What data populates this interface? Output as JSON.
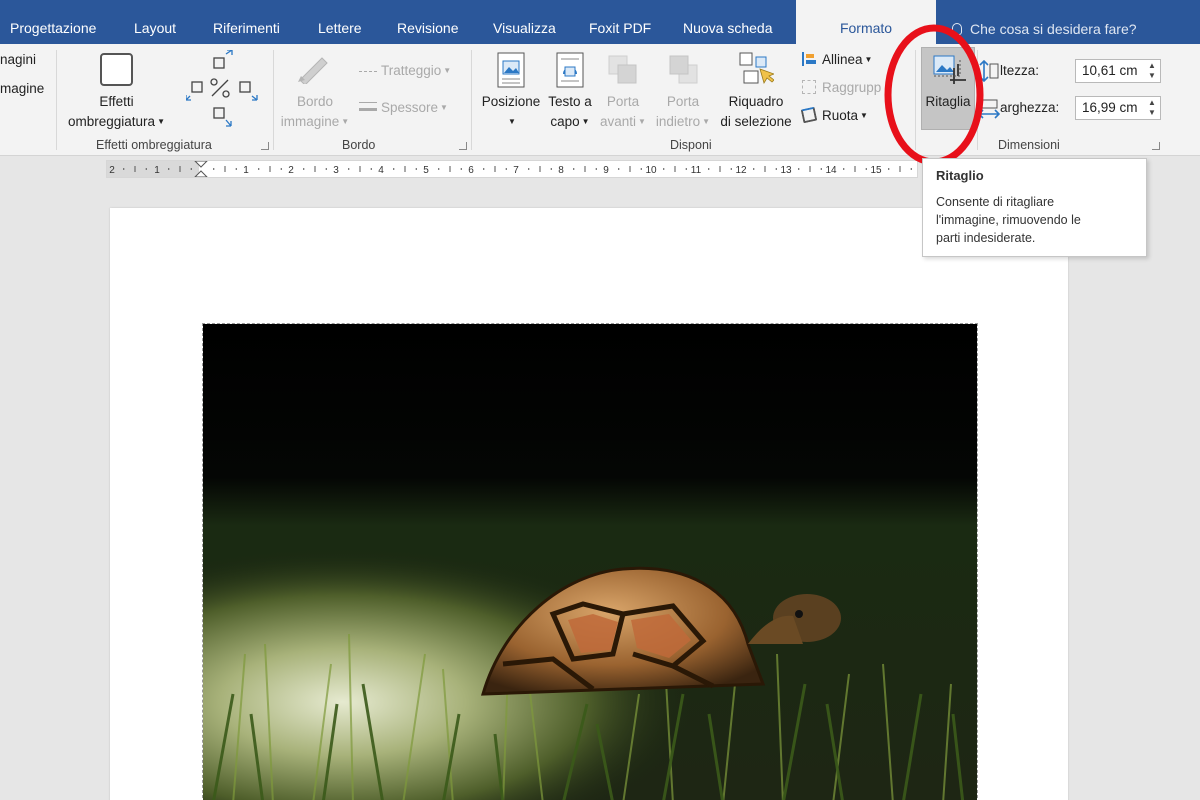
{
  "tabs": [
    {
      "label": "Progettazione"
    },
    {
      "label": "Layout"
    },
    {
      "label": "Riferimenti"
    },
    {
      "label": "Lettere"
    },
    {
      "label": "Revisione"
    },
    {
      "label": "Visualizza"
    },
    {
      "label": "Foxit PDF"
    },
    {
      "label": "Nuova scheda"
    },
    {
      "label": "Formato"
    }
  ],
  "tell_me": "Che cosa si desidera fare?",
  "ribbon": {
    "partial_items": [
      "nagini",
      "magine"
    ],
    "effetti_ombreggiatura": {
      "button_line1": "Effetti",
      "button_line2": "ombreggiatura",
      "group_label": "Effetti ombreggiatura"
    },
    "bordo": {
      "button_line1": "Bordo",
      "button_line2": "immagine",
      "tratteggio": "Tratteggio",
      "spessore": "Spessore",
      "group_label": "Bordo"
    },
    "disponi": {
      "posizione": "Posizione",
      "testo_line1": "Testo a",
      "testo_line2": "capo",
      "avanti_line1": "Porta",
      "avanti_line2": "avanti",
      "indietro_line1": "Porta",
      "indietro_line2": "indietro",
      "riquadro_line1": "Riquadro",
      "riquadro_line2": "di selezione",
      "allinea": "Allinea",
      "raggruppa": "Raggrupp",
      "ruota": "Ruota",
      "group_label": "Disponi"
    },
    "ritaglia": "Ritaglia",
    "dimensioni": {
      "altezza_label": "ltezza:",
      "altezza_value": "10,61 cm",
      "larghezza_label": "arghezza:",
      "larghezza_value": "16,99 cm",
      "group_label": "Dimensioni"
    }
  },
  "ruler": {
    "left_numbers": [
      "2",
      "1"
    ],
    "numbers": [
      "1",
      "2",
      "3",
      "4",
      "5",
      "6",
      "7",
      "8",
      "9",
      "10",
      "11",
      "12",
      "13",
      "14",
      "15"
    ]
  },
  "tooltip": {
    "title": "Ritaglio",
    "line1": "Consente di ritagliare",
    "line2": "l'immagine, rimuovendo le",
    "line3": "parti indesiderate."
  },
  "colors": {
    "tab_bar": "#2b579a",
    "ribbon": "#f3f3f3",
    "highlight_circle": "#e8101a",
    "pressed_button": "#c5c5c5"
  }
}
